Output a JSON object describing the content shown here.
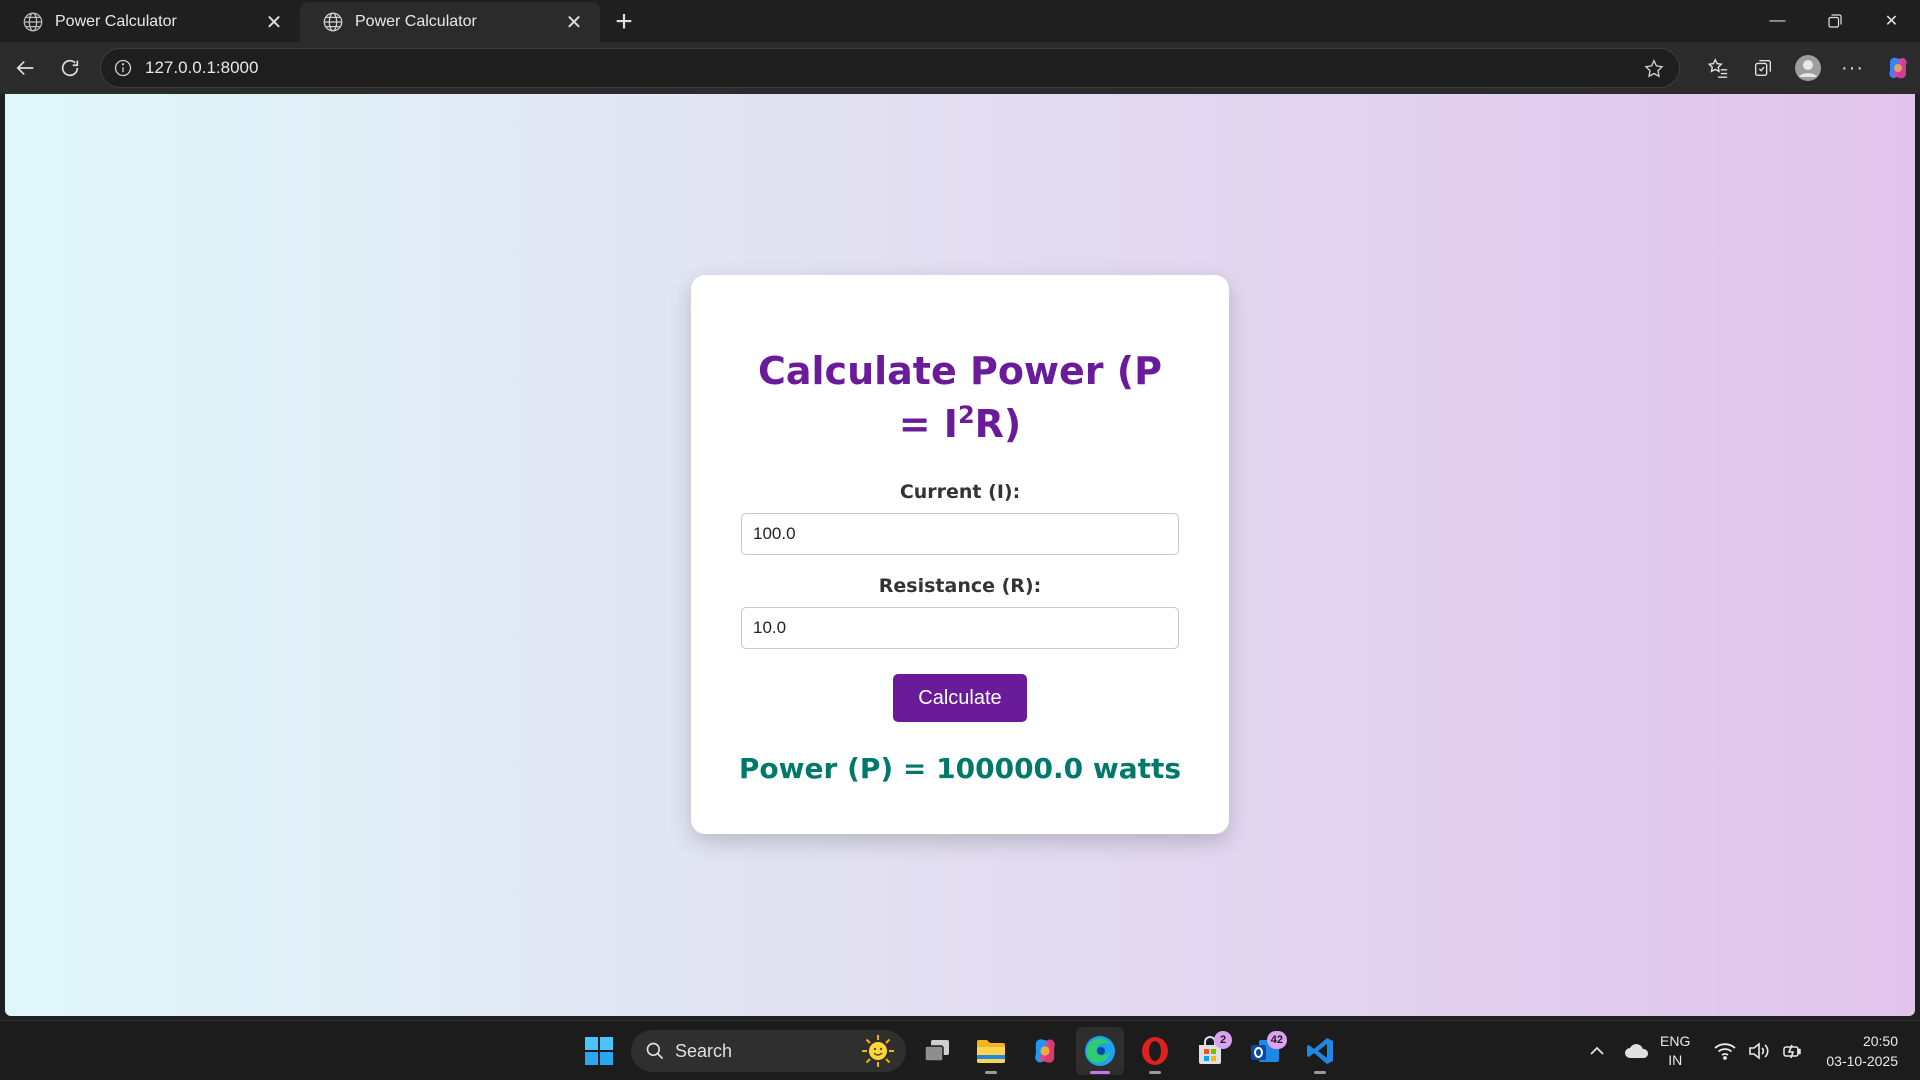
{
  "browser": {
    "tabs": [
      {
        "title": "Power Calculator",
        "active": false
      },
      {
        "title": "Power Calculator",
        "active": true
      }
    ],
    "url": "127.0.0.1:8000"
  },
  "page": {
    "heading_main": "Calculate Power (P = I",
    "heading_sup": "2",
    "heading_end": "R)",
    "current_label": "Current (I):",
    "current_value": "100.0",
    "resistance_label": "Resistance (R):",
    "resistance_value": "10.0",
    "button_label": "Calculate",
    "result": "Power (P) = 100000.0 watts",
    "colors": {
      "heading": "#6a1b9a",
      "button": "#6a1b9a",
      "result": "#00796b"
    }
  },
  "taskbar": {
    "search_label": "Search",
    "badges": {
      "store": "2",
      "mail": "42"
    },
    "apps": [
      "windows-start-icon",
      "search-icon",
      "task-view-icon",
      "file-explorer-icon",
      "copilot-icon",
      "edge-icon",
      "opera-icon",
      "microsoft-store-icon",
      "outlook-icon",
      "vscode-icon"
    ]
  },
  "tray": {
    "lang_line1": "ENG",
    "lang_line2": "IN",
    "time": "20:50",
    "date": "03-10-2025"
  }
}
